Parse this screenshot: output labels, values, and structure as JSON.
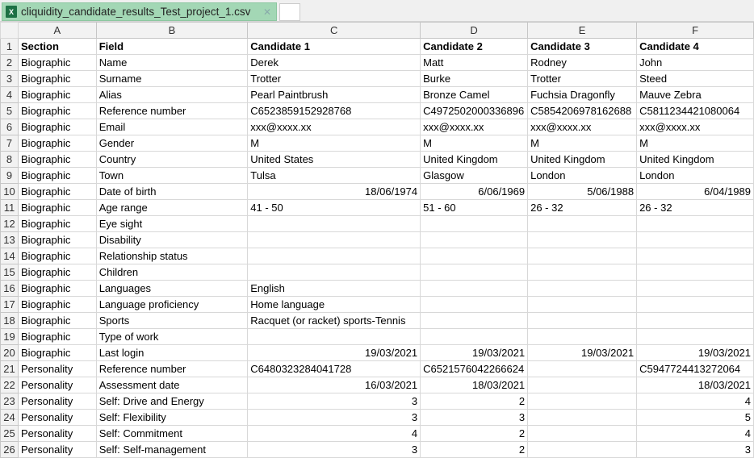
{
  "tab": {
    "title": "cliquidity_candidate_results_Test_project_1.csv",
    "icon": "excel-icon"
  },
  "columns": [
    "A",
    "B",
    "C",
    "D",
    "E",
    "F"
  ],
  "rows": [
    [
      "Section",
      "Field",
      "Candidate 1",
      "Candidate 2",
      "Candidate 3",
      "Candidate 4"
    ],
    [
      "Biographic",
      "Name",
      "Derek",
      "Matt",
      "Rodney",
      "John"
    ],
    [
      "Biographic",
      "Surname",
      "Trotter",
      "Burke",
      "Trotter",
      "Steed"
    ],
    [
      "Biographic",
      "Alias",
      "Pearl Paintbrush",
      "Bronze Camel",
      "Fuchsia Dragonfly",
      "Mauve Zebra"
    ],
    [
      "Biographic",
      "Reference number",
      "C6523859152928768",
      "C4972502000336896",
      "C5854206978162688",
      "C5811234421080064"
    ],
    [
      "Biographic",
      "Email",
      "xxx@xxxx.xx",
      "xxx@xxxx.xx",
      "xxx@xxxx.xx",
      "xxx@xxxx.xx"
    ],
    [
      "Biographic",
      "Gender",
      "M",
      "M",
      "M",
      "M"
    ],
    [
      "Biographic",
      "Country",
      "United States",
      "United Kingdom",
      "United Kingdom",
      "United Kingdom"
    ],
    [
      "Biographic",
      "Town",
      "Tulsa",
      "Glasgow",
      "London",
      "London"
    ],
    [
      "Biographic",
      "Date of birth",
      "18/06/1974",
      "6/06/1969",
      "5/06/1988",
      "6/04/1989"
    ],
    [
      "Biographic",
      "Age range",
      "41 - 50",
      "51 - 60",
      "26 - 32",
      "26 - 32"
    ],
    [
      "Biographic",
      "Eye sight",
      "",
      "",
      "",
      ""
    ],
    [
      "Biographic",
      "Disability",
      "",
      "",
      "",
      ""
    ],
    [
      "Biographic",
      "Relationship status",
      "",
      "",
      "",
      ""
    ],
    [
      "Biographic",
      "Children",
      "",
      "",
      "",
      ""
    ],
    [
      "Biographic",
      "Languages",
      "English",
      "",
      "",
      ""
    ],
    [
      "Biographic",
      "Language proficiency",
      "Home language",
      "",
      "",
      ""
    ],
    [
      "Biographic",
      "Sports",
      "Racquet (or racket) sports-Tennis",
      "",
      "",
      ""
    ],
    [
      "Biographic",
      "Type of work",
      "",
      "",
      "",
      ""
    ],
    [
      "Biographic",
      "Last login",
      "19/03/2021",
      "19/03/2021",
      "19/03/2021",
      "19/03/2021"
    ],
    [
      "Personality",
      "Reference number",
      "C6480323284041728",
      "C6521576042266624",
      "",
      "C5947724413272064"
    ],
    [
      "Personality",
      "Assessment date",
      "16/03/2021",
      "18/03/2021",
      "",
      "18/03/2021"
    ],
    [
      "Personality",
      "Self: Drive and Energy",
      "3",
      "2",
      "",
      "4"
    ],
    [
      "Personality",
      "Self: Flexibility",
      "3",
      "3",
      "",
      "5"
    ],
    [
      "Personality",
      "Self: Commitment",
      "4",
      "2",
      "",
      "4"
    ],
    [
      "Personality",
      "Self: Self-management",
      "3",
      "2",
      "",
      "3"
    ]
  ]
}
